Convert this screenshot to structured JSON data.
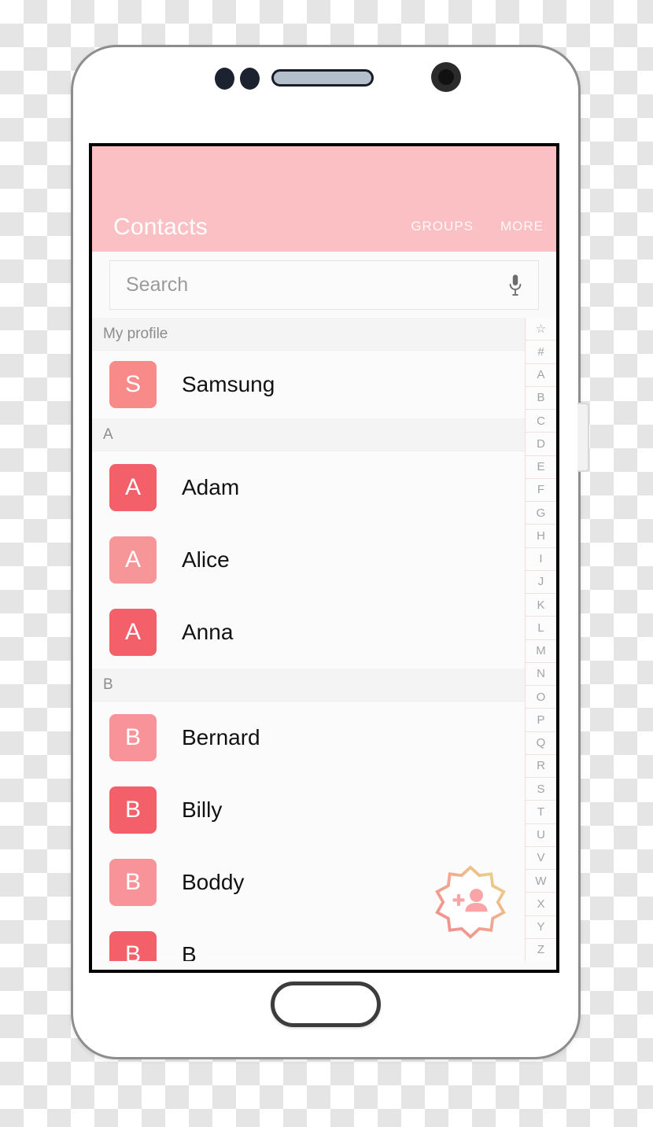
{
  "device": {
    "name": "samsung-galaxy-phone-mockup",
    "hardware": {
      "speaker": "speaker-grille",
      "front_camera": "front-camera",
      "proximity_sensor": "proximity-sensor",
      "home_button": "home-button",
      "volume_up": "volume-up-button",
      "volume_down": "volume-down-button",
      "power": "power-button"
    }
  },
  "appbar": {
    "title": "Contacts",
    "actions": [
      {
        "label": "GROUPS",
        "name": "groups-tab"
      },
      {
        "label": "MORE",
        "name": "more-tab"
      }
    ],
    "background_color": "#FAC0C3",
    "text_color": "#FFFFFF"
  },
  "search": {
    "placeholder": "Search",
    "value": "",
    "mic_icon": "microphone-icon"
  },
  "list": {
    "sections": [
      {
        "header": "My profile",
        "contacts": [
          {
            "name": "Samsung",
            "initial": "S",
            "color": "#F98A8A"
          }
        ]
      },
      {
        "header": "A",
        "contacts": [
          {
            "name": "Adam",
            "initial": "A",
            "color": "#F4606A"
          },
          {
            "name": "Alice",
            "initial": "A",
            "color": "#F79699"
          },
          {
            "name": "Anna",
            "initial": "A",
            "color": "#F4606A"
          }
        ]
      },
      {
        "header": "B",
        "contacts": [
          {
            "name": "Bernard",
            "initial": "B",
            "color": "#F89499"
          },
          {
            "name": "Billy",
            "initial": "B",
            "color": "#F4606A"
          },
          {
            "name": "Boddy",
            "initial": "B",
            "color": "#F89499"
          },
          {
            "name": "B",
            "initial": "B",
            "color": "#F4606A"
          }
        ]
      }
    ]
  },
  "alpha_index": {
    "items": [
      "☆",
      "#",
      "A",
      "B",
      "C",
      "D",
      "E",
      "F",
      "G",
      "H",
      "I",
      "J",
      "K",
      "L",
      "M",
      "N",
      "O",
      "P",
      "Q",
      "R",
      "S",
      "T",
      "U",
      "V",
      "W",
      "X",
      "Y",
      "Z"
    ]
  },
  "fab": {
    "name": "add-contact-fab",
    "icon": "add-person-icon",
    "gradient_from": "#F59EA2",
    "gradient_to": "#EDD98A",
    "icon_color": "#F8A5A8"
  },
  "colors": {
    "accent": "#FAC0C3",
    "avatar_strong": "#F4606A",
    "avatar_light": "#F89499",
    "screen_bg": "#FAFAFA",
    "section_bg": "#F4F4F4"
  }
}
